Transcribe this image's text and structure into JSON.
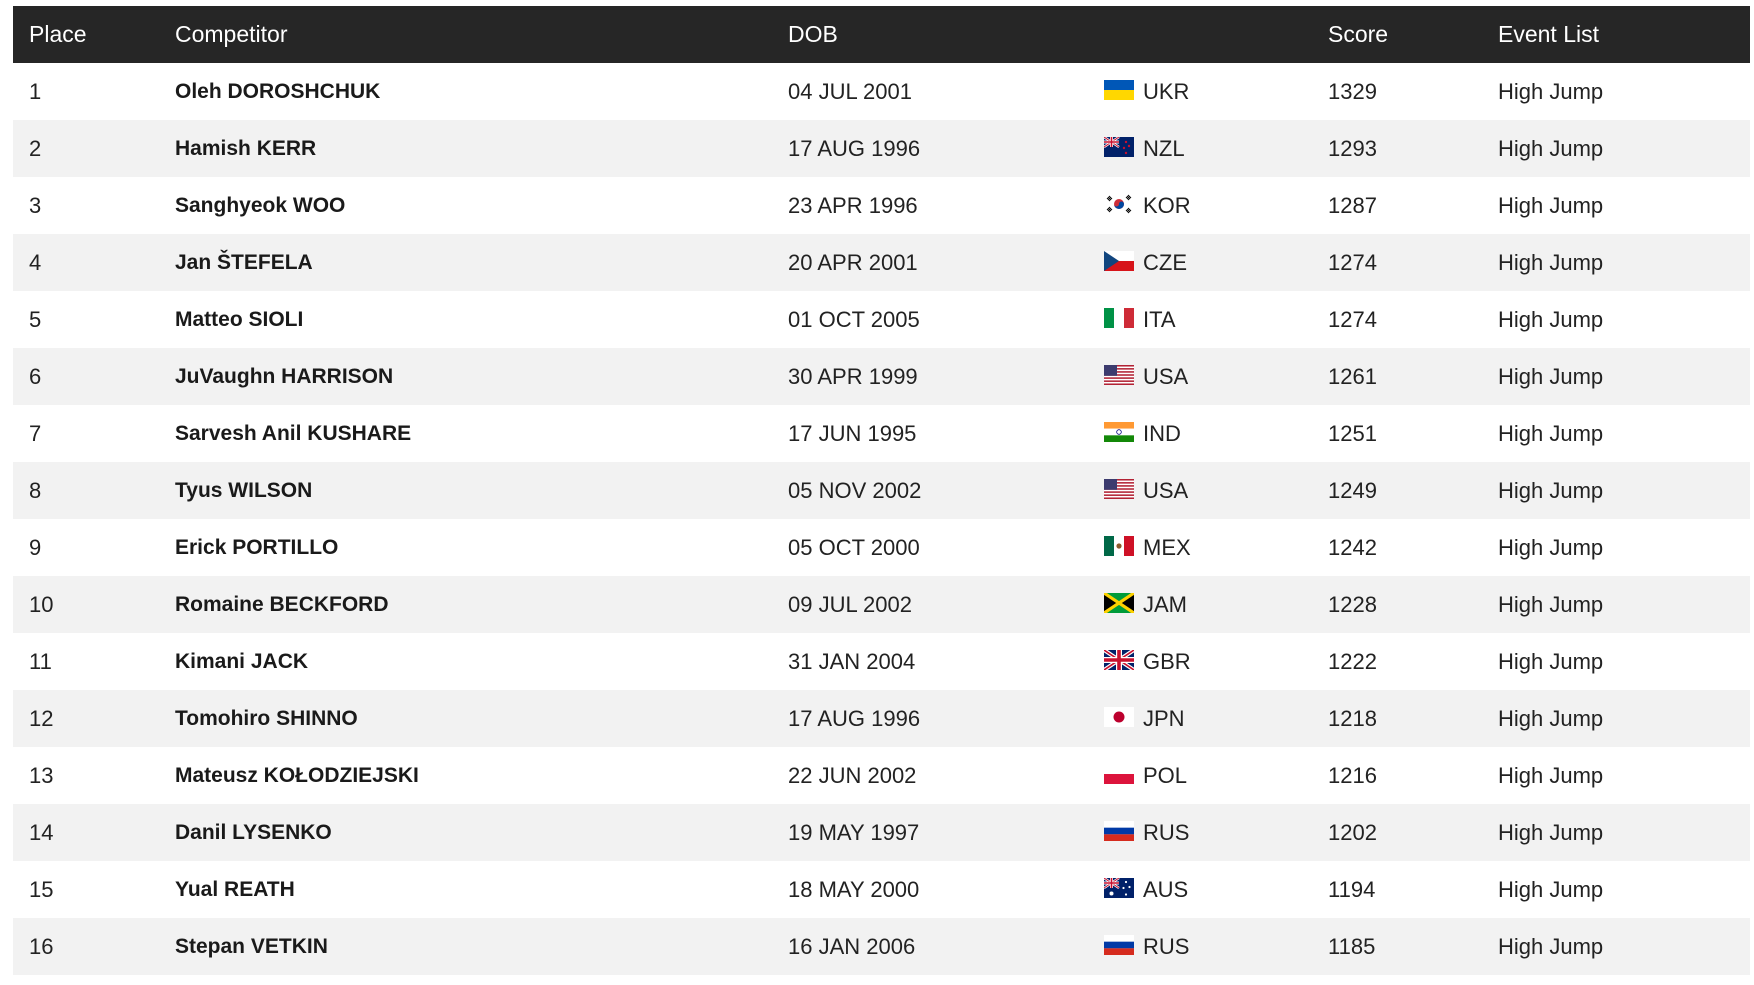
{
  "table": {
    "headers": {
      "place": "Place",
      "competitor": "Competitor",
      "dob": "DOB",
      "nat": "",
      "score": "Score",
      "events": "Event List"
    },
    "rows": [
      {
        "place": "1",
        "competitor": "Oleh DOROSHCHUK",
        "dob": "04 JUL 2001",
        "nat": "UKR",
        "flag": "flag-ukr-icon",
        "score": "1329",
        "events": "High Jump"
      },
      {
        "place": "2",
        "competitor": "Hamish KERR",
        "dob": "17 AUG 1996",
        "nat": "NZL",
        "flag": "flag-nzl-icon",
        "score": "1293",
        "events": "High Jump"
      },
      {
        "place": "3",
        "competitor": "Sanghyeok WOO",
        "dob": "23 APR 1996",
        "nat": "KOR",
        "flag": "flag-kor-icon",
        "score": "1287",
        "events": "High Jump"
      },
      {
        "place": "4",
        "competitor": "Jan ŠTEFELA",
        "dob": "20 APR 2001",
        "nat": "CZE",
        "flag": "flag-cze-icon",
        "score": "1274",
        "events": "High Jump"
      },
      {
        "place": "5",
        "competitor": "Matteo SIOLI",
        "dob": "01 OCT 2005",
        "nat": "ITA",
        "flag": "flag-ita-icon",
        "score": "1274",
        "events": "High Jump"
      },
      {
        "place": "6",
        "competitor": "JuVaughn HARRISON",
        "dob": "30 APR 1999",
        "nat": "USA",
        "flag": "flag-usa-icon",
        "score": "1261",
        "events": "High Jump"
      },
      {
        "place": "7",
        "competitor": "Sarvesh Anil KUSHARE",
        "dob": "17 JUN 1995",
        "nat": "IND",
        "flag": "flag-ind-icon",
        "score": "1251",
        "events": "High Jump"
      },
      {
        "place": "8",
        "competitor": "Tyus WILSON",
        "dob": "05 NOV 2002",
        "nat": "USA",
        "flag": "flag-usa-icon",
        "score": "1249",
        "events": "High Jump"
      },
      {
        "place": "9",
        "competitor": "Erick PORTILLO",
        "dob": "05 OCT 2000",
        "nat": "MEX",
        "flag": "flag-mex-icon",
        "score": "1242",
        "events": "High Jump"
      },
      {
        "place": "10",
        "competitor": "Romaine BECKFORD",
        "dob": "09 JUL 2002",
        "nat": "JAM",
        "flag": "flag-jam-icon",
        "score": "1228",
        "events": "High Jump"
      },
      {
        "place": "11",
        "competitor": "Kimani JACK",
        "dob": "31 JAN 2004",
        "nat": "GBR",
        "flag": "flag-gbr-icon",
        "score": "1222",
        "events": "High Jump"
      },
      {
        "place": "12",
        "competitor": "Tomohiro SHINNO",
        "dob": "17 AUG 1996",
        "nat": "JPN",
        "flag": "flag-jpn-icon",
        "score": "1218",
        "events": "High Jump"
      },
      {
        "place": "13",
        "competitor": "Mateusz KOŁODZIEJSKI",
        "dob": "22 JUN 2002",
        "nat": "POL",
        "flag": "flag-pol-icon",
        "score": "1216",
        "events": "High Jump"
      },
      {
        "place": "14",
        "competitor": "Danil LYSENKO",
        "dob": "19 MAY 1997",
        "nat": "RUS",
        "flag": "flag-rus-icon",
        "score": "1202",
        "events": "High Jump"
      },
      {
        "place": "15",
        "competitor": "Yual REATH",
        "dob": "18 MAY 2000",
        "nat": "AUS",
        "flag": "flag-aus-icon",
        "score": "1194",
        "events": "High Jump"
      },
      {
        "place": "16",
        "competitor": "Stepan VETKIN",
        "dob": "16 JAN 2006",
        "nat": "RUS",
        "flag": "flag-rus-icon",
        "score": "1185",
        "events": "High Jump"
      }
    ]
  },
  "colors": {
    "header_bg": "#262626",
    "header_text": "#ffffff",
    "row_alt_bg": "#f2f2f2",
    "row_bg": "#ffffff"
  }
}
